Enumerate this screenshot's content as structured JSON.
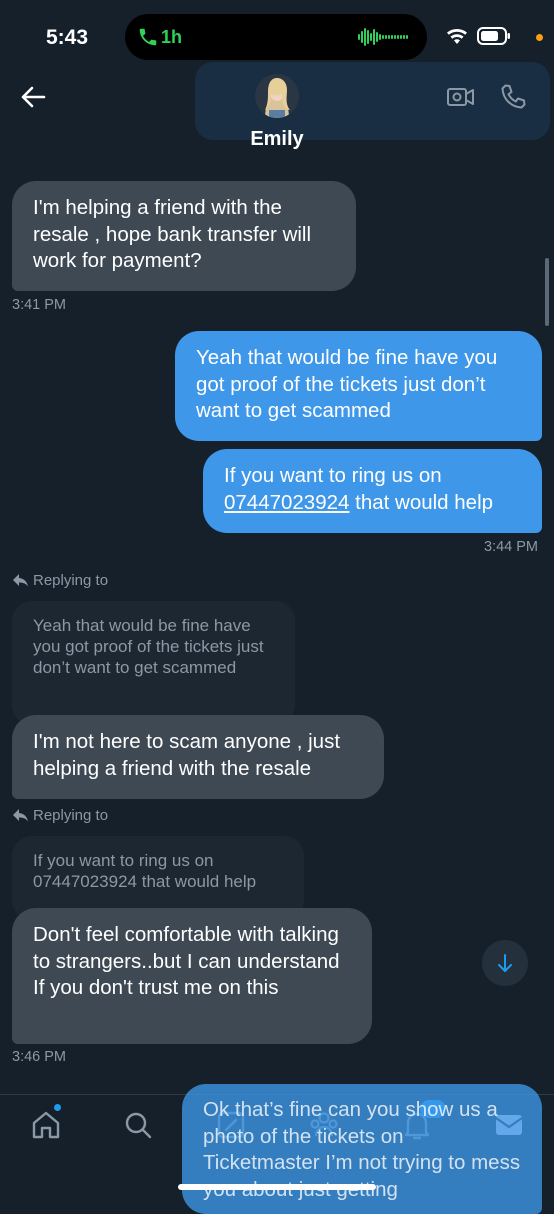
{
  "status_bar": {
    "time": "5:43",
    "call_duration": "1h"
  },
  "header": {
    "contact_name": "Emily"
  },
  "messages": [
    {
      "text": "I'm helping a friend with the resale , hope bank transfer will work for payment?"
    },
    {
      "timestamp": "3:41 PM"
    },
    {
      "text": "Yeah that would be fine have you got proof of the tickets just don’t want to get scammed"
    },
    {
      "text_before": "If you want to ring us on",
      "phone": "07447023924",
      "text_after": "that would help"
    },
    {
      "timestamp": "3:44 PM"
    },
    {
      "reply_label": "Replying to",
      "quoted": "Yeah that would be fine have you got proof of the tickets just don’t want to get scammed",
      "text": "I'm not here to scam anyone , just helping a friend with the resale"
    },
    {
      "reply_label": "Replying to",
      "quoted": "If you want to ring us on 07447023924 that would help",
      "text": "Don't feel comfortable with talking to strangers..but I can understand If you don't trust me on this"
    },
    {
      "timestamp": "3:46 PM"
    }
  ],
  "draft": {
    "text": "Ok that’s fine can you show us a photo of the tickets on Ticketmaster I’m not trying to mess you about just getting"
  },
  "nav": [
    "home-icon",
    "search-icon",
    "compose-icon",
    "communities-icon",
    "notifications-icon",
    "messages-icon"
  ],
  "colors": {
    "background": "#15202b",
    "incoming": "#3e4954",
    "outgoing": "#3e97e8",
    "accent": "#1d9bf0"
  }
}
